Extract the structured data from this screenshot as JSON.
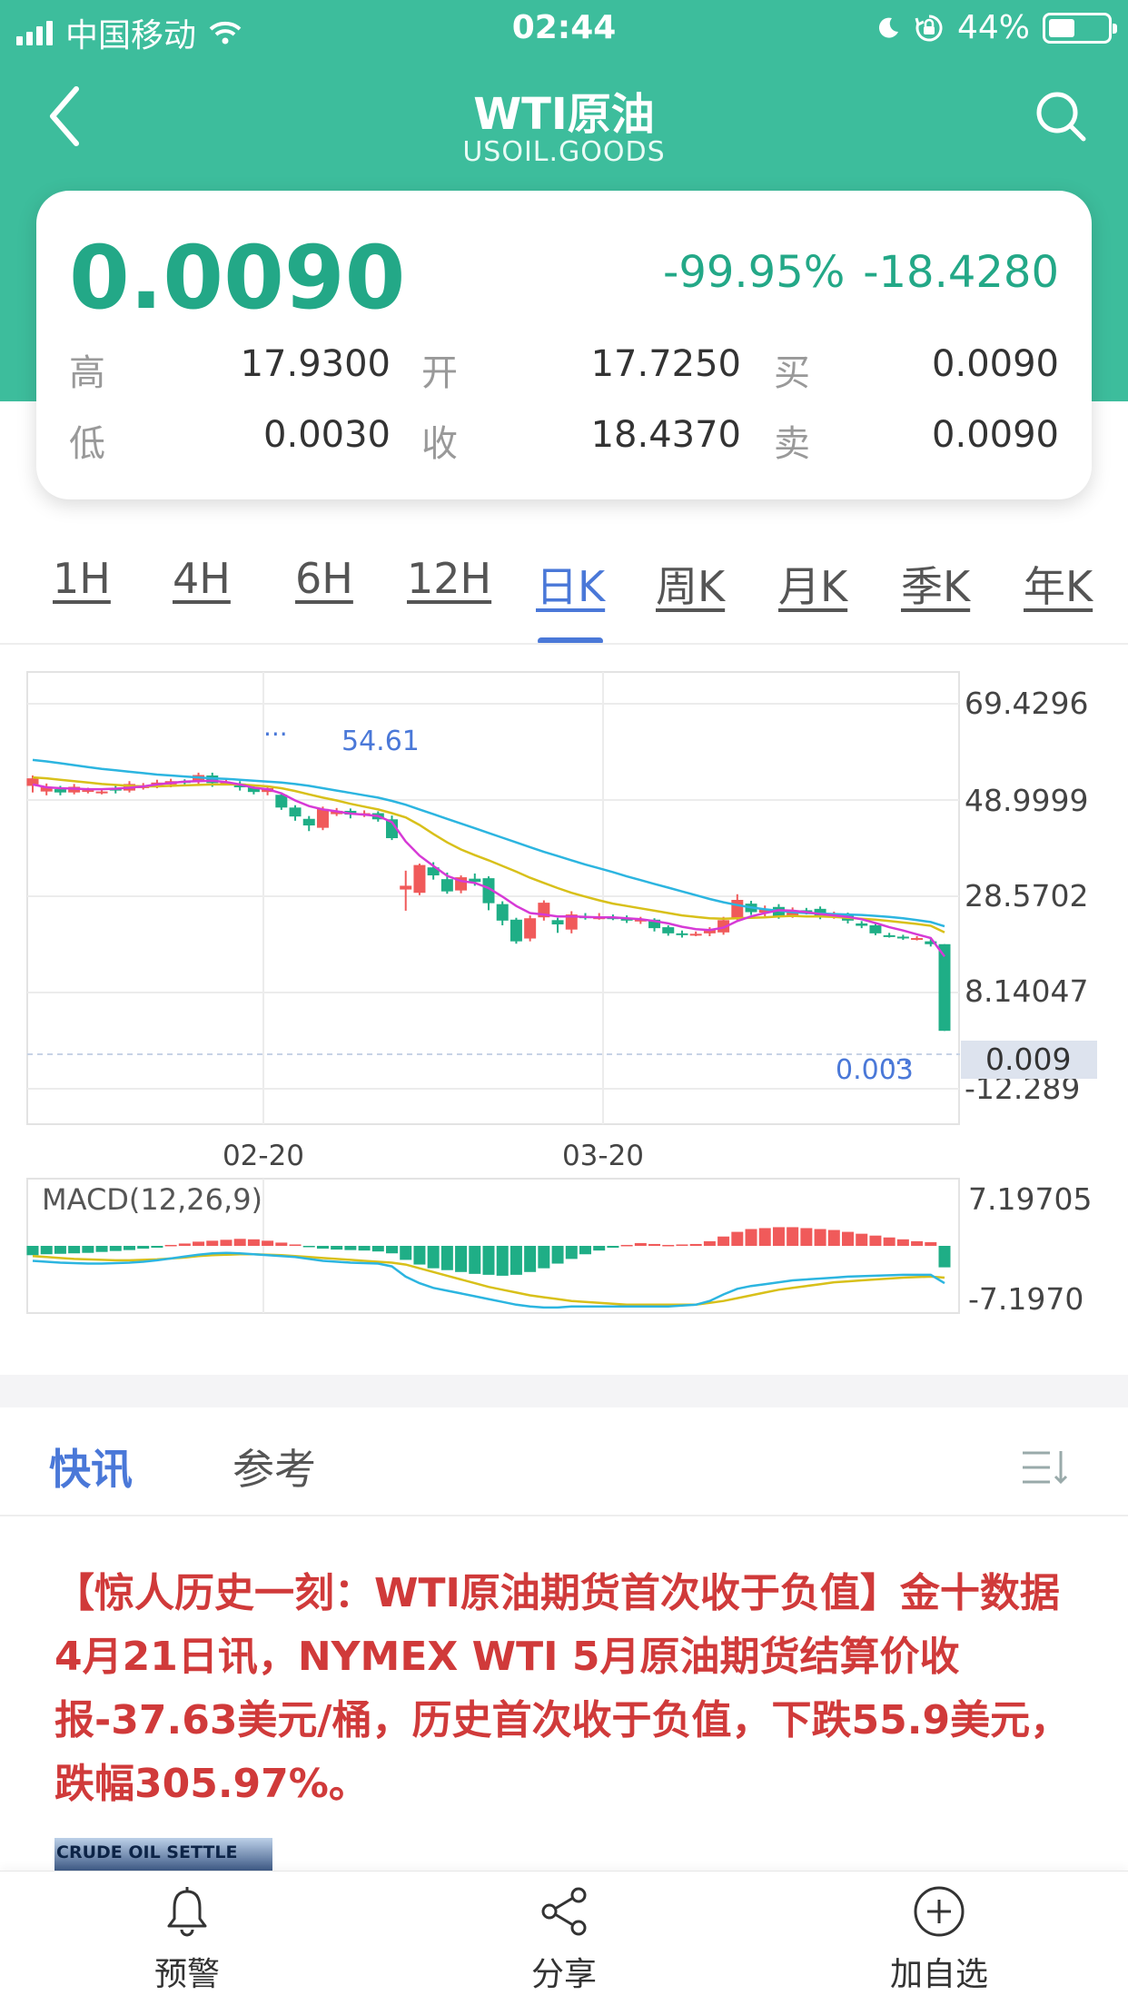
{
  "status_bar": {
    "carrier": "中国移动",
    "time": "02:44",
    "battery": "44%"
  },
  "header": {
    "title": "WTI原油",
    "subtitle": "USOIL.GOODS",
    "back_icon": "chevron-left-icon",
    "search_icon": "search-icon"
  },
  "quote": {
    "price": "0.0090",
    "change_pct": "-99.95%",
    "change": "-18.4280",
    "high_label": "高",
    "high": "17.9300",
    "open_label": "开",
    "open": "17.7250",
    "bid_label": "买",
    "bid": "0.0090",
    "low_label": "低",
    "low": "0.0030",
    "close_label": "收",
    "close": "18.4370",
    "ask_label": "卖",
    "ask": "0.0090",
    "up_color": "#23a887"
  },
  "periods": {
    "items": [
      "1H",
      "4H",
      "6H",
      "12H",
      "日K",
      "周K",
      "月K",
      "季K",
      "年K"
    ],
    "active": "日K"
  },
  "chart_data": [
    {
      "type": "candlestick",
      "y_ticks": [
        "69.4296",
        "48.9999",
        "28.5702",
        "8.14047",
        "-12.289"
      ],
      "ylim": [
        -12.289,
        69.4296
      ],
      "x_ticks": [
        "02-20",
        "03-20"
      ],
      "last_price_label": "0.009",
      "high_marker": "54.61",
      "low_marker": "0.003",
      "colors": {
        "up": "#f05a5a",
        "down": "#1fae86",
        "ma5": "#d63ad6",
        "ma10": "#d8c01a",
        "ma20": "#2cb5e0"
      },
      "candles": [
        [
          52.0,
          53.6,
          50.6,
          54.2
        ],
        [
          50.8,
          51.8,
          50.0,
          52.5
        ],
        [
          51.3,
          50.6,
          50.0,
          52.0
        ],
        [
          50.6,
          51.8,
          50.2,
          52.4
        ],
        [
          50.8,
          51.1,
          50.4,
          51.6
        ],
        [
          50.8,
          50.8,
          50.2,
          51.3
        ],
        [
          51.6,
          51.0,
          50.4,
          52.2
        ],
        [
          51.0,
          52.4,
          50.6,
          53.0
        ],
        [
          51.6,
          51.9,
          51.2,
          52.6
        ],
        [
          52.1,
          52.7,
          51.5,
          53.3
        ],
        [
          52.3,
          53.0,
          51.7,
          53.5
        ],
        [
          53.0,
          52.9,
          52.3,
          53.4
        ],
        [
          53.0,
          54.3,
          52.4,
          54.8
        ],
        [
          54.2,
          52.6,
          51.8,
          54.8
        ],
        [
          52.6,
          52.8,
          52.1,
          53.4
        ],
        [
          52.5,
          51.7,
          51.0,
          53.0
        ],
        [
          51.7,
          50.7,
          50.2,
          52.2
        ],
        [
          50.7,
          51.5,
          50.0,
          52.0
        ],
        [
          50.1,
          47.4,
          46.9,
          50.6
        ],
        [
          47.4,
          45.5,
          44.6,
          47.9
        ],
        [
          45.0,
          43.6,
          42.4,
          45.6
        ],
        [
          43.1,
          47.1,
          42.6,
          47.6
        ],
        [
          46.0,
          46.7,
          45.6,
          47.3
        ],
        [
          46.7,
          45.9,
          45.1,
          47.2
        ],
        [
          45.9,
          46.2,
          45.4,
          46.8
        ],
        [
          46.2,
          44.9,
          44.4,
          46.6
        ],
        [
          44.9,
          40.9,
          40.5,
          45.7
        ],
        [
          30.0,
          30.8,
          25.5,
          34.0
        ],
        [
          29.3,
          35.2,
          28.8,
          35.5
        ],
        [
          34.7,
          33.0,
          32.1,
          35.8
        ],
        [
          32.2,
          29.6,
          29.1,
          33.6
        ],
        [
          29.8,
          32.6,
          29.2,
          33.0
        ],
        [
          32.3,
          31.6,
          30.8,
          33.4
        ],
        [
          32.4,
          27.1,
          25.6,
          32.8
        ],
        [
          26.9,
          23.4,
          22.4,
          27.5
        ],
        [
          23.6,
          19.0,
          18.5,
          24.0
        ],
        [
          19.6,
          23.9,
          19.0,
          24.5
        ],
        [
          24.1,
          27.2,
          23.4,
          27.7
        ],
        [
          23.5,
          22.6,
          20.8,
          24.0
        ],
        [
          21.5,
          24.7,
          20.7,
          25.4
        ],
        [
          24.3,
          24.1,
          23.6,
          25.0
        ],
        [
          24.1,
          24.1,
          23.6,
          25.0
        ],
        [
          24.1,
          24.0,
          23.5,
          24.7
        ],
        [
          24.0,
          23.4,
          22.9,
          24.5
        ],
        [
          23.4,
          23.6,
          22.7,
          24.2
        ],
        [
          23.6,
          21.8,
          21.1,
          23.9
        ],
        [
          22.0,
          20.7,
          20.2,
          22.4
        ],
        [
          20.7,
          20.6,
          19.8,
          21.3
        ],
        [
          20.6,
          20.6,
          20.1,
          21.1
        ],
        [
          20.7,
          21.4,
          20.1,
          22.0
        ],
        [
          20.9,
          23.5,
          20.4,
          24.2
        ],
        [
          24.0,
          27.8,
          23.5,
          29.0
        ],
        [
          27.0,
          25.2,
          24.6,
          27.6
        ],
        [
          25.1,
          25.8,
          24.3,
          26.6
        ],
        [
          26.3,
          24.4,
          23.8,
          26.9
        ],
        [
          24.5,
          25.5,
          24.0,
          26.2
        ],
        [
          25.6,
          25.3,
          24.7,
          26.1
        ],
        [
          25.9,
          24.2,
          23.7,
          26.4
        ],
        [
          24.3,
          24.7,
          23.8,
          25.3
        ],
        [
          24.8,
          23.4,
          22.8,
          25.1
        ],
        [
          22.8,
          22.3,
          21.8,
          23.3
        ],
        [
          22.4,
          20.7,
          20.3,
          22.8
        ],
        [
          20.3,
          20.2,
          19.8,
          20.8
        ],
        [
          20.0,
          19.7,
          19.3,
          20.4
        ],
        [
          19.6,
          19.7,
          19.2,
          20.1
        ],
        [
          19.0,
          18.4,
          17.9,
          19.5
        ],
        [
          18.4,
          0.009,
          0.003,
          18.4
        ]
      ],
      "ma5": [
        52.3,
        51.7,
        51.5,
        51.4,
        51.3,
        51.3,
        51.4,
        51.6,
        51.9,
        52.3,
        52.6,
        52.9,
        53.0,
        53.1,
        52.8,
        52.3,
        51.6,
        51.3,
        50.4,
        48.9,
        47.7,
        47.0,
        46.6,
        46.1,
        45.9,
        45.6,
        44.3,
        40.2,
        37.2,
        35.0,
        32.9,
        31.8,
        31.4,
        30.3,
        28.5,
        26.5,
        25.0,
        24.7,
        24.3,
        24.3,
        24.2,
        24.1,
        24.1,
        23.9,
        23.7,
        23.3,
        22.8,
        22.1,
        21.6,
        21.4,
        21.9,
        23.3,
        24.3,
        25.0,
        25.6,
        25.5,
        25.2,
        24.8,
        24.5,
        24.2,
        23.7,
        22.9,
        22.0,
        21.3,
        20.5,
        19.7,
        15.8
      ],
      "ma10": [
        53.8,
        53.6,
        53.3,
        53.0,
        52.7,
        52.4,
        52.2,
        52.0,
        51.9,
        51.9,
        52.0,
        52.1,
        52.2,
        52.3,
        52.3,
        52.3,
        52.1,
        51.9,
        51.5,
        50.9,
        50.2,
        49.5,
        48.9,
        48.2,
        47.6,
        47.0,
        46.2,
        45.3,
        43.7,
        41.8,
        40.0,
        38.5,
        37.3,
        36.2,
        35.0,
        33.8,
        32.5,
        31.4,
        30.3,
        29.3,
        28.5,
        27.7,
        27.0,
        26.5,
        26.0,
        25.5,
        25.0,
        24.5,
        24.2,
        23.9,
        23.8,
        23.9,
        24.0,
        24.1,
        24.3,
        24.4,
        24.3,
        24.3,
        24.2,
        24.0,
        23.8,
        23.6,
        23.3,
        23.0,
        22.7,
        22.3,
        20.9
      ],
      "ma20": [
        57.5,
        57.2,
        56.8,
        56.4,
        56.0,
        55.6,
        55.3,
        55.0,
        54.7,
        54.4,
        54.2,
        54.0,
        53.8,
        53.6,
        53.5,
        53.3,
        53.1,
        52.9,
        52.7,
        52.4,
        52.0,
        51.5,
        51.0,
        50.5,
        50.0,
        49.5,
        48.8,
        48.0,
        47.0,
        46.0,
        45.0,
        44.0,
        43.0,
        42.0,
        41.0,
        40.0,
        39.0,
        38.0,
        37.1,
        36.2,
        35.3,
        34.5,
        33.7,
        32.8,
        32.0,
        31.2,
        30.4,
        29.6,
        28.8,
        28.0,
        27.3,
        26.7,
        26.2,
        25.8,
        25.5,
        25.2,
        25.0,
        24.9,
        24.8,
        24.7,
        24.6,
        24.4,
        24.2,
        23.9,
        23.5,
        23.1,
        22.2
      ]
    },
    {
      "type": "macd",
      "title": "MACD(12,26,9)",
      "y_ticks": [
        "7.19705",
        "-7.1970"
      ],
      "ylim": [
        -7.197,
        7.19705
      ],
      "hist": [
        -1.0,
        -0.9,
        -0.85,
        -0.8,
        -0.75,
        -0.65,
        -0.55,
        -0.45,
        -0.3,
        -0.2,
        0.1,
        0.25,
        0.45,
        0.55,
        0.65,
        0.75,
        0.7,
        0.55,
        0.35,
        0.15,
        -0.1,
        -0.3,
        -0.4,
        -0.45,
        -0.5,
        -0.6,
        -0.8,
        -1.5,
        -2.0,
        -2.4,
        -2.6,
        -2.8,
        -3.0,
        -3.1,
        -3.2,
        -3.1,
        -2.8,
        -2.4,
        -1.9,
        -1.4,
        -0.9,
        -0.5,
        -0.2,
        0.1,
        0.3,
        0.2,
        0.1,
        0.15,
        0.2,
        0.5,
        1.0,
        1.5,
        1.8,
        1.9,
        2.0,
        2.0,
        1.9,
        1.8,
        1.7,
        1.5,
        1.3,
        1.1,
        0.9,
        0.7,
        0.5,
        0.4,
        -2.3
      ],
      "dif": [
        -1.6,
        -1.7,
        -1.8,
        -1.85,
        -1.9,
        -1.9,
        -1.85,
        -1.8,
        -1.7,
        -1.55,
        -1.35,
        -1.15,
        -0.95,
        -0.8,
        -0.75,
        -0.8,
        -0.9,
        -1.0,
        -1.1,
        -1.2,
        -1.4,
        -1.6,
        -1.7,
        -1.8,
        -1.85,
        -1.9,
        -2.2,
        -3.3,
        -4.0,
        -4.5,
        -4.8,
        -5.1,
        -5.4,
        -5.7,
        -6.0,
        -6.3,
        -6.5,
        -6.6,
        -6.6,
        -6.5,
        -6.5,
        -6.5,
        -6.5,
        -6.5,
        -6.5,
        -6.5,
        -6.5,
        -6.4,
        -6.3,
        -5.9,
        -5.2,
        -4.6,
        -4.3,
        -4.1,
        -3.9,
        -3.7,
        -3.6,
        -3.5,
        -3.4,
        -3.3,
        -3.25,
        -3.2,
        -3.15,
        -3.1,
        -3.1,
        -3.1,
        -4.0
      ],
      "dea": [
        -1.1,
        -1.2,
        -1.3,
        -1.4,
        -1.45,
        -1.5,
        -1.55,
        -1.55,
        -1.5,
        -1.45,
        -1.35,
        -1.25,
        -1.1,
        -1.0,
        -0.95,
        -0.9,
        -0.9,
        -0.95,
        -1.0,
        -1.1,
        -1.2,
        -1.3,
        -1.4,
        -1.5,
        -1.6,
        -1.7,
        -1.8,
        -2.0,
        -2.4,
        -2.8,
        -3.2,
        -3.6,
        -4.0,
        -4.4,
        -4.7,
        -5.0,
        -5.3,
        -5.5,
        -5.7,
        -5.9,
        -6.0,
        -6.1,
        -6.2,
        -6.3,
        -6.3,
        -6.3,
        -6.3,
        -6.3,
        -6.3,
        -6.1,
        -5.9,
        -5.6,
        -5.3,
        -5.0,
        -4.7,
        -4.5,
        -4.3,
        -4.1,
        -3.9,
        -3.8,
        -3.7,
        -3.6,
        -3.5,
        -3.4,
        -3.35,
        -3.3,
        -3.4
      ]
    }
  ],
  "news_tabs": {
    "items": [
      "快讯",
      "参考"
    ],
    "active": "快讯",
    "list_icon": "sort-list-icon"
  },
  "news": {
    "text": "【惊人历史一刻：WTI原油期货首次收于负值】金十数据4月21日讯，NYMEX WTI 5月原油期货结算价收报-37.63美元/桶，历史首次收于负值，下跌55.9美元，跌幅305.97%。",
    "thumbnail_caption": "CRUDE OIL SETTLE"
  },
  "bottom_bar": {
    "alert": "预警",
    "alert_icon": "bell-icon",
    "share": "分享",
    "share_icon": "share-icon",
    "watchlist": "加自选",
    "watchlist_icon": "plus-circle-icon"
  }
}
